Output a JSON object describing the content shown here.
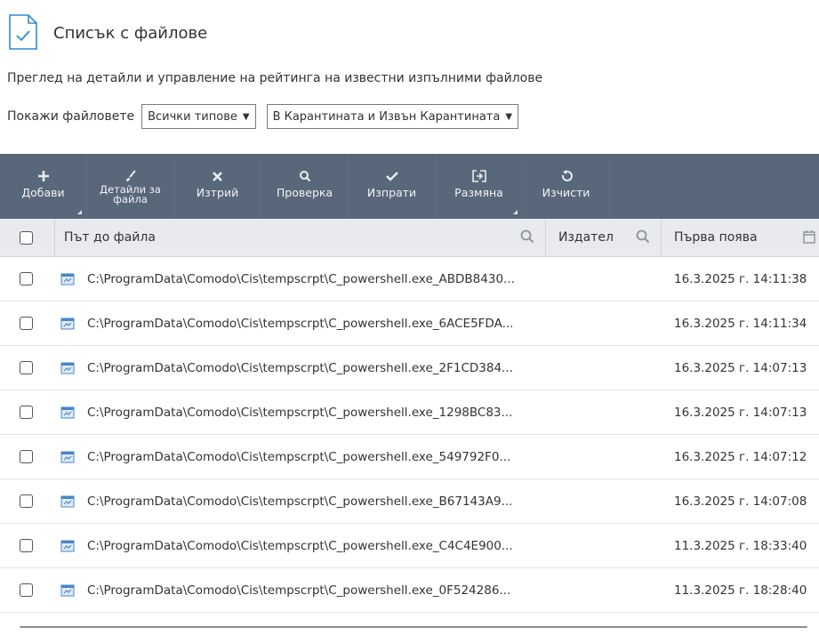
{
  "header": {
    "title": "Списък с файлове",
    "icon": "document-check-icon"
  },
  "subtitle": "Преглед на детайли и управление на рейтинга на известни изпълними файлове",
  "filters": {
    "label": "Покажи файловете",
    "type_select": "Всички типове",
    "quarantine_select": "В Карантината и Извън Карантината"
  },
  "toolbar": {
    "add": "Добави",
    "details_line1": "Детайли за",
    "details_line2": "файла",
    "delete": "Изтрий",
    "check": "Проверка",
    "send": "Изпрати",
    "exchange": "Размяна",
    "clear": "Изчисти"
  },
  "columns": {
    "path": "Път до файла",
    "publisher": "Издател",
    "first_seen": "Първа поява"
  },
  "rows": [
    {
      "path": "C:\\ProgramData\\Comodo\\Cis\\tempscrpt\\C_powershell.exe_ABDB8430...",
      "date": "16.3.2025 г. 14:11:38"
    },
    {
      "path": "C:\\ProgramData\\Comodo\\Cis\\tempscrpt\\C_powershell.exe_6ACE5FDA...",
      "date": "16.3.2025 г. 14:11:34"
    },
    {
      "path": "C:\\ProgramData\\Comodo\\Cis\\tempscrpt\\C_powershell.exe_2F1CD384...",
      "date": "16.3.2025 г. 14:07:13"
    },
    {
      "path": "C:\\ProgramData\\Comodo\\Cis\\tempscrpt\\C_powershell.exe_1298BC83...",
      "date": "16.3.2025 г. 14:07:13"
    },
    {
      "path": "C:\\ProgramData\\Comodo\\Cis\\tempscrpt\\C_powershell.exe_549792F0...",
      "date": "16.3.2025 г. 14:07:12"
    },
    {
      "path": "C:\\ProgramData\\Comodo\\Cis\\tempscrpt\\C_powershell.exe_B67143A9...",
      "date": "16.3.2025 г. 14:07:08"
    },
    {
      "path": "C:\\ProgramData\\Comodo\\Cis\\tempscrpt\\C_powershell.exe_C4C4E900...",
      "date": "11.3.2025 г. 18:33:40"
    },
    {
      "path": "C:\\ProgramData\\Comodo\\Cis\\tempscrpt\\C_powershell.exe_0F524286...",
      "date": "11.3.2025 г. 18:28:40"
    }
  ],
  "colors": {
    "toolbar_bg": "#58677a",
    "header_bg": "#e8eaee",
    "accent_blue": "#2e8ccf"
  }
}
